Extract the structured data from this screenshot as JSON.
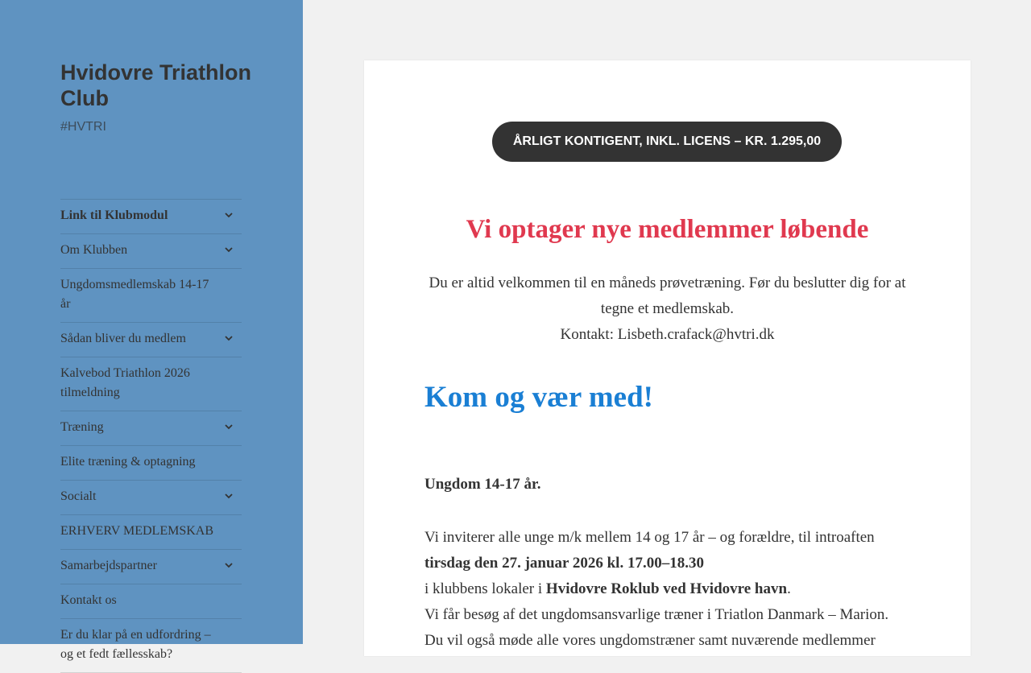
{
  "sidebar": {
    "site_title": "Hvidovre Triathlon Club",
    "site_description": "#HVTRI",
    "nav_items": [
      {
        "label": "Link til Klubmodul",
        "has_children": true,
        "active": true
      },
      {
        "label": "Om Klubben",
        "has_children": true
      },
      {
        "label": "Ungdomsmedlemskab 14-17 år",
        "has_children": false
      },
      {
        "label": "Sådan bliver du medlem",
        "has_children": true
      },
      {
        "label": "Kalvebod Triathlon 2026 tilmeldning",
        "has_children": false
      },
      {
        "label": "Træning",
        "has_children": true
      },
      {
        "label": "Elite træning & optagning",
        "has_children": false
      },
      {
        "label": "Socialt",
        "has_children": true
      },
      {
        "label": "ERHVERV MEDLEMSKAB",
        "has_children": false
      },
      {
        "label": "Samarbejdspartner",
        "has_children": true
      },
      {
        "label": "Kontakt os",
        "has_children": false
      },
      {
        "label": "Er du klar på en udfordring – og et fedt fællesskab?",
        "has_children": false
      }
    ],
    "toggle_icon": "chevron-down-icon"
  },
  "main": {
    "fee_button": "ÅRLIGT KONTIGENT, INKL. LICENS – KR. 1.295,00",
    "headline": "Vi optager nye medlemmer løbende",
    "intro": "Du er altid velkommen til en måneds prøvetræning. Før du beslutter dig for at tegne et medlemskab.",
    "contact": "Kontakt: Lisbeth.crafack@hvtri.dk",
    "join_heading": "Kom og vær med!",
    "youth_heading": "Ungdom 14-17 år.",
    "youth_line1": "Vi inviterer alle unge m/k mellem 14 og 17 år – og forældre, til introaften",
    "youth_date": "tirsdag den 27. januar 2026 kl. 17.00–18.30",
    "youth_location_prefix": "i klubbens lokaler i ",
    "youth_location": "Hvidovre Roklub ved Hvidovre havn",
    "youth_location_suffix": ".",
    "youth_line3": "Vi får besøg af det ungdomsansvarlige træner i Triatlon Danmark – Marion.",
    "youth_line4": "Du vil også møde alle vores ungdomstræner samt nuværende medlemmer"
  },
  "colors": {
    "sidebar_bg": "#5f93c1",
    "headline_red": "#e0394f",
    "heading_blue": "#1a7fd4",
    "button_dark": "#333333"
  }
}
